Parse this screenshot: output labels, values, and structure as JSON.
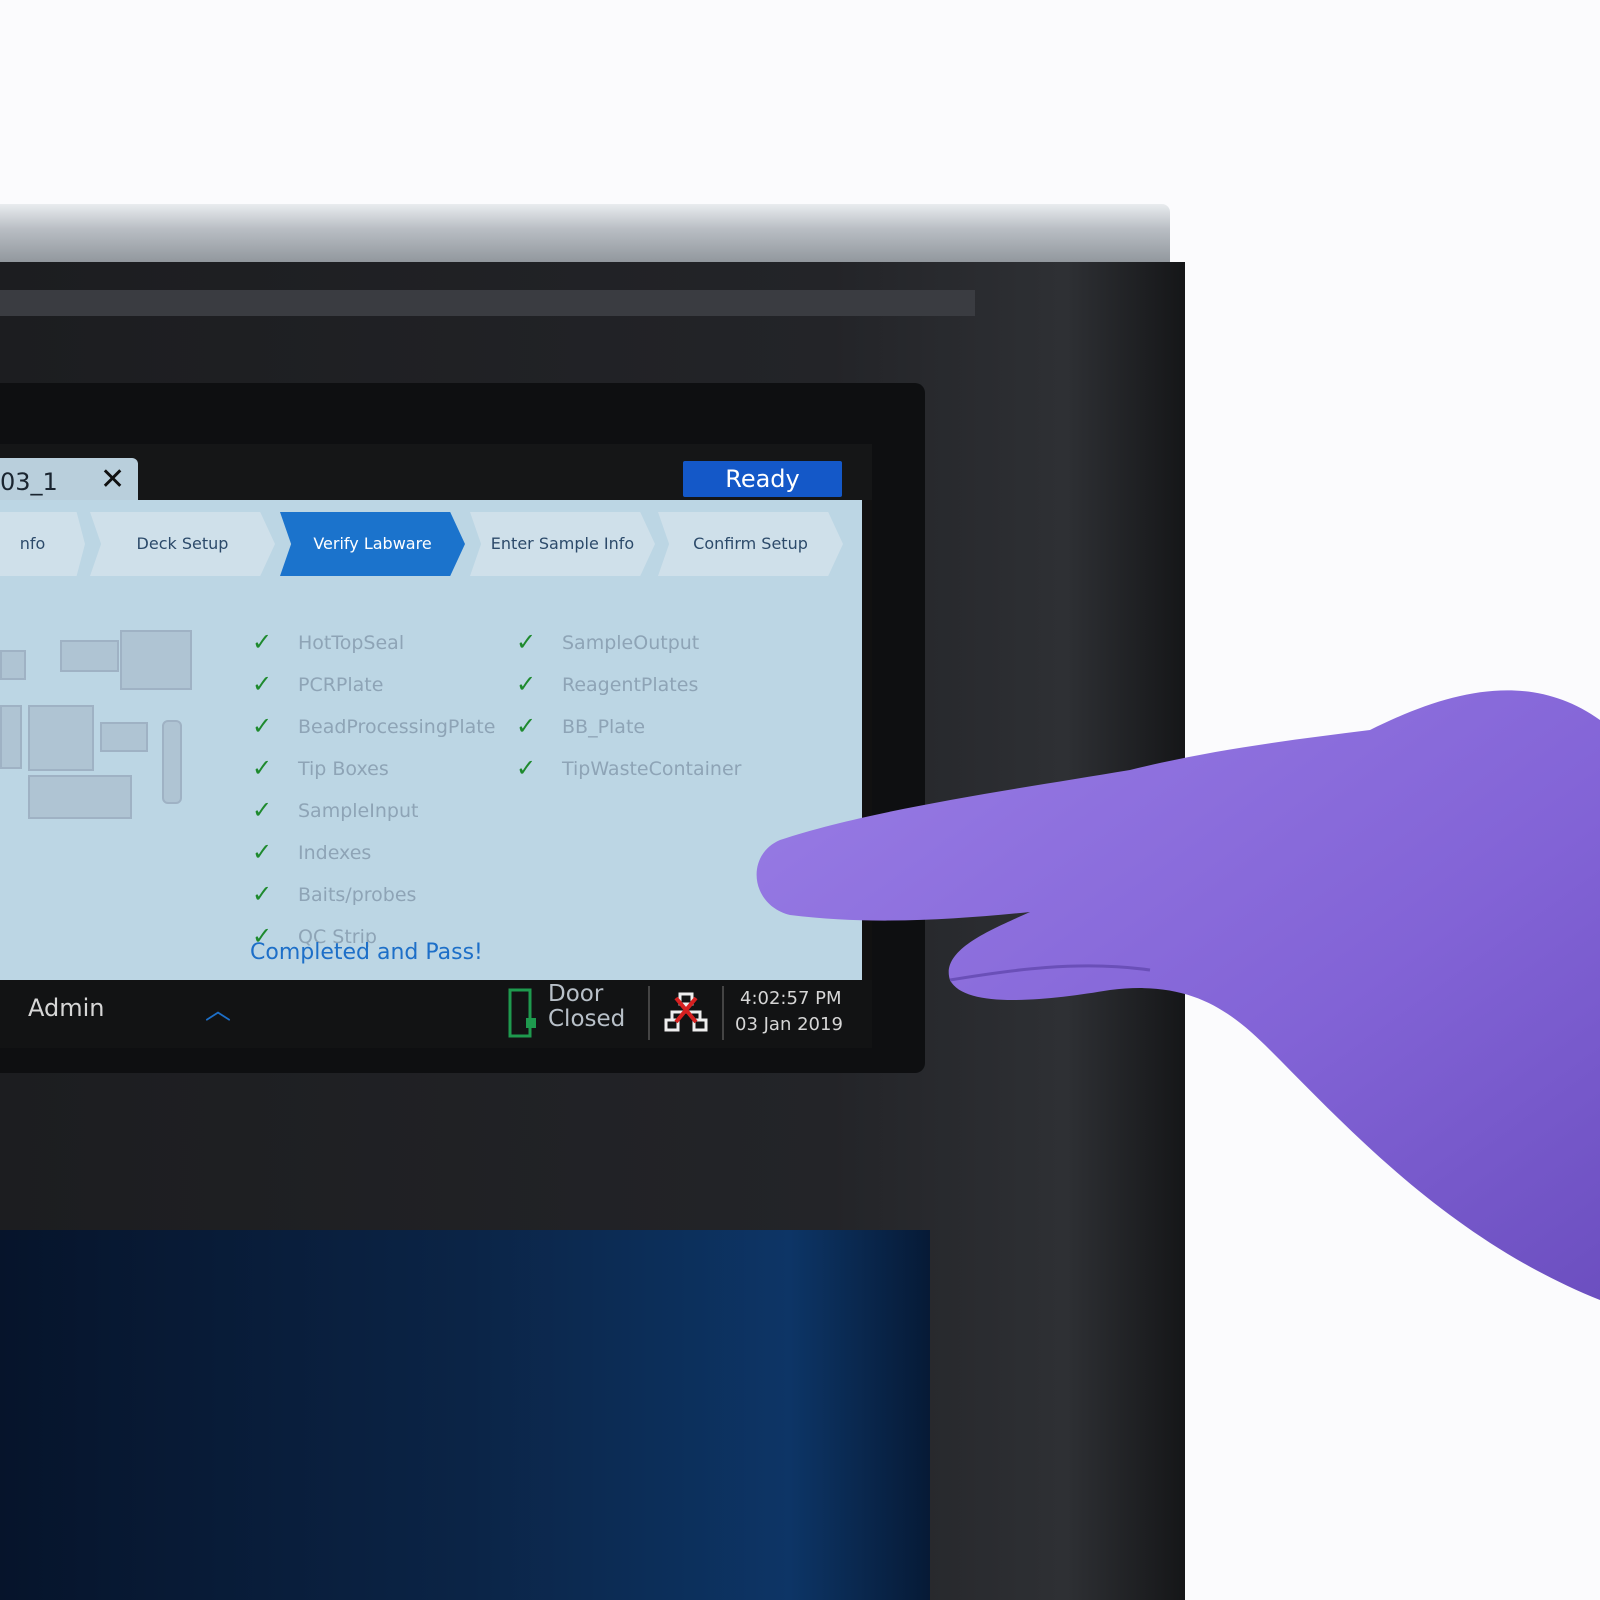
{
  "tab": {
    "name": "03_1",
    "close_icon": "close-icon"
  },
  "status_badge": {
    "label": "Ready",
    "color": "#1458c8"
  },
  "steps": [
    {
      "label": "nfo",
      "active": false
    },
    {
      "label": "Deck Setup",
      "active": false
    },
    {
      "label": "Verify Labware",
      "active": true
    },
    {
      "label": "Enter Sample Info",
      "active": false
    },
    {
      "label": "Confirm Setup",
      "active": false
    }
  ],
  "checklist": {
    "left": [
      "HotTopSeal",
      "PCRPlate",
      "BeadProcessingPlate",
      "Tip Boxes",
      "SampleInput",
      "Indexes",
      "Baits/probes",
      "QC Strip"
    ],
    "right": [
      "SampleOutput",
      "ReagentPlates",
      "BB_Plate",
      "TipWasteContainer"
    ]
  },
  "result_message": "Completed and Pass!",
  "statusbar": {
    "user": "Admin",
    "door_line1": "Door",
    "door_line2": "Closed",
    "time": "4:02:57 PM",
    "date": "03 Jan 2019"
  },
  "colors": {
    "accent": "#1b73cc",
    "check": "#1e8a2e"
  }
}
